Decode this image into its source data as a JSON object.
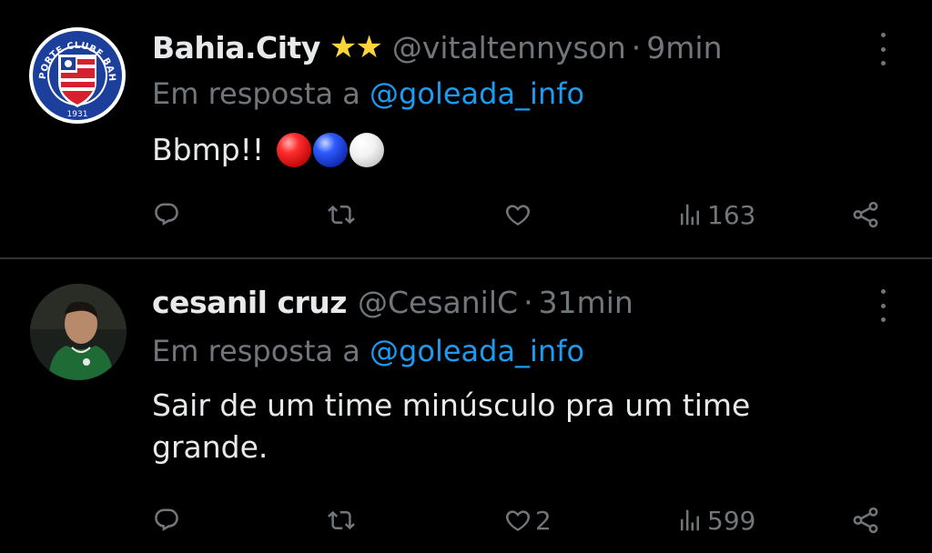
{
  "tweets": [
    {
      "display_name": "Bahia.City",
      "badge": "★★",
      "handle": "@vitaltennyson",
      "separator": "·",
      "time": "9min",
      "reply_prefix": "Em resposta a",
      "reply_to": "@goleada_info",
      "text": "Bbmp!!",
      "avatar_text": {
        "top": "ESPORTE CLUBE BAHIA",
        "year": "1931"
      },
      "metrics": {
        "replies": "",
        "retweets": "",
        "likes": "",
        "views": "163"
      }
    },
    {
      "display_name": "cesanil cruz",
      "handle": "@CesanilC",
      "separator": "·",
      "time": "31min",
      "reply_prefix": "Em resposta a",
      "reply_to": "@goleada_info",
      "text_line1": "Sair de um time minúsculo pra um time",
      "text_line2": "grande.",
      "metrics": {
        "replies": "",
        "retweets": "",
        "likes": "2",
        "views": "599"
      }
    }
  ],
  "icons": {
    "reply": "reply-icon",
    "retweet": "retweet-icon",
    "like": "heart-icon",
    "views": "views-icon",
    "share": "share-icon",
    "more": "more-vertical-icon"
  },
  "colors": {
    "background": "#000000",
    "text": "#e7e9ea",
    "secondary": "#71767b",
    "link": "#1d9bf0",
    "divider": "#2f3336",
    "stars": "#ffd43b"
  }
}
